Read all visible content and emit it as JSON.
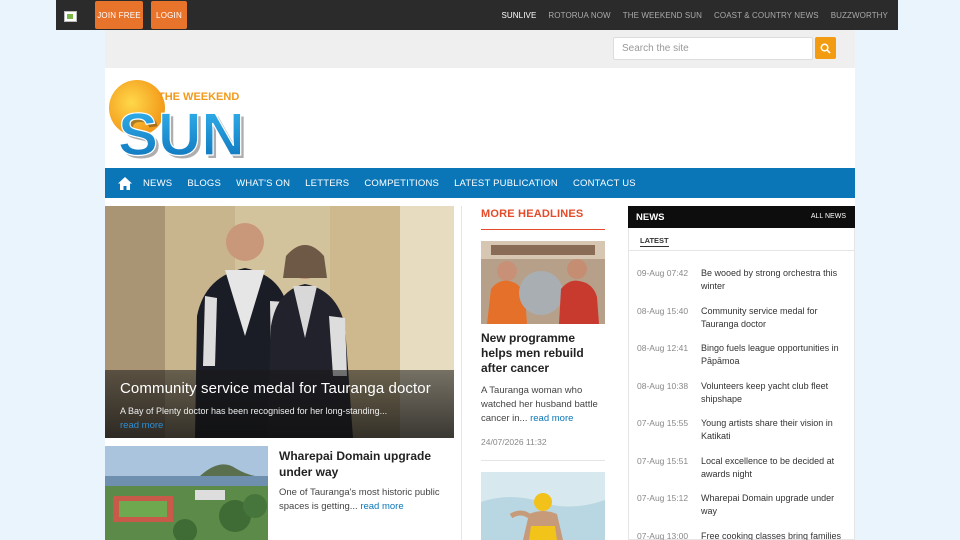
{
  "topbar": {
    "join_label": "JOIN FREE",
    "login_label": "LOGIN",
    "links": [
      "SUNLIVE",
      "ROTORUA NOW",
      "THE WEEKEND SUN",
      "COAST & COUNTRY NEWS",
      "BUZZWORTHY"
    ]
  },
  "search": {
    "placeholder": "Search the site"
  },
  "logo": {
    "top": "THE WEEKEND",
    "main": "SUN"
  },
  "nav": {
    "items": [
      "NEWS",
      "BLOGS",
      "WHAT'S ON",
      "LETTERS",
      "COMPETITIONS",
      "LATEST PUBLICATION",
      "CONTACT US"
    ]
  },
  "hero": {
    "title": "Community service medal for Tauranga doctor",
    "desc": "A Bay of Plenty doctor has been recognised for her long-standing...",
    "read_more": "read more"
  },
  "story2": {
    "title": "Wharepai Domain upgrade under way",
    "desc": "One of Tauranga's most historic public spaces is getting...",
    "read_more": "read more"
  },
  "more_headlines": {
    "title": "MORE HEADLINES",
    "item1": {
      "title": "New programme helps men rebuild after cancer",
      "desc": "A Tauranga woman who watched her husband battle cancer in...",
      "read_more": "read more",
      "date": "24/07/2026 11:32"
    }
  },
  "news": {
    "title": "NEWS",
    "all_label": "ALL NEWS",
    "tab": "LATEST",
    "items": [
      {
        "date": "09-Aug 07:42",
        "headline": "Be wooed by strong orchestra this winter"
      },
      {
        "date": "08-Aug 15:40",
        "headline": "Community service medal for Tauranga doctor"
      },
      {
        "date": "08-Aug 12:41",
        "headline": "Bingo fuels league opportunities in Pāpāmoa"
      },
      {
        "date": "08-Aug 10:38",
        "headline": "Volunteers keep yacht club fleet shipshape"
      },
      {
        "date": "07-Aug 15:55",
        "headline": "Young artists share their vision in Katikati"
      },
      {
        "date": "07-Aug 15:51",
        "headline": "Local excellence to be decided at awards night"
      },
      {
        "date": "07-Aug 15:12",
        "headline": "Wharepai Domain upgrade under way"
      },
      {
        "date": "07-Aug 13:00",
        "headline": "Free cooking classes bring families"
      }
    ]
  },
  "colors": {
    "nav": "#0a76b8",
    "join": "#e8732a",
    "headline_red": "#e44b2a",
    "search_btn": "#f39c12"
  }
}
